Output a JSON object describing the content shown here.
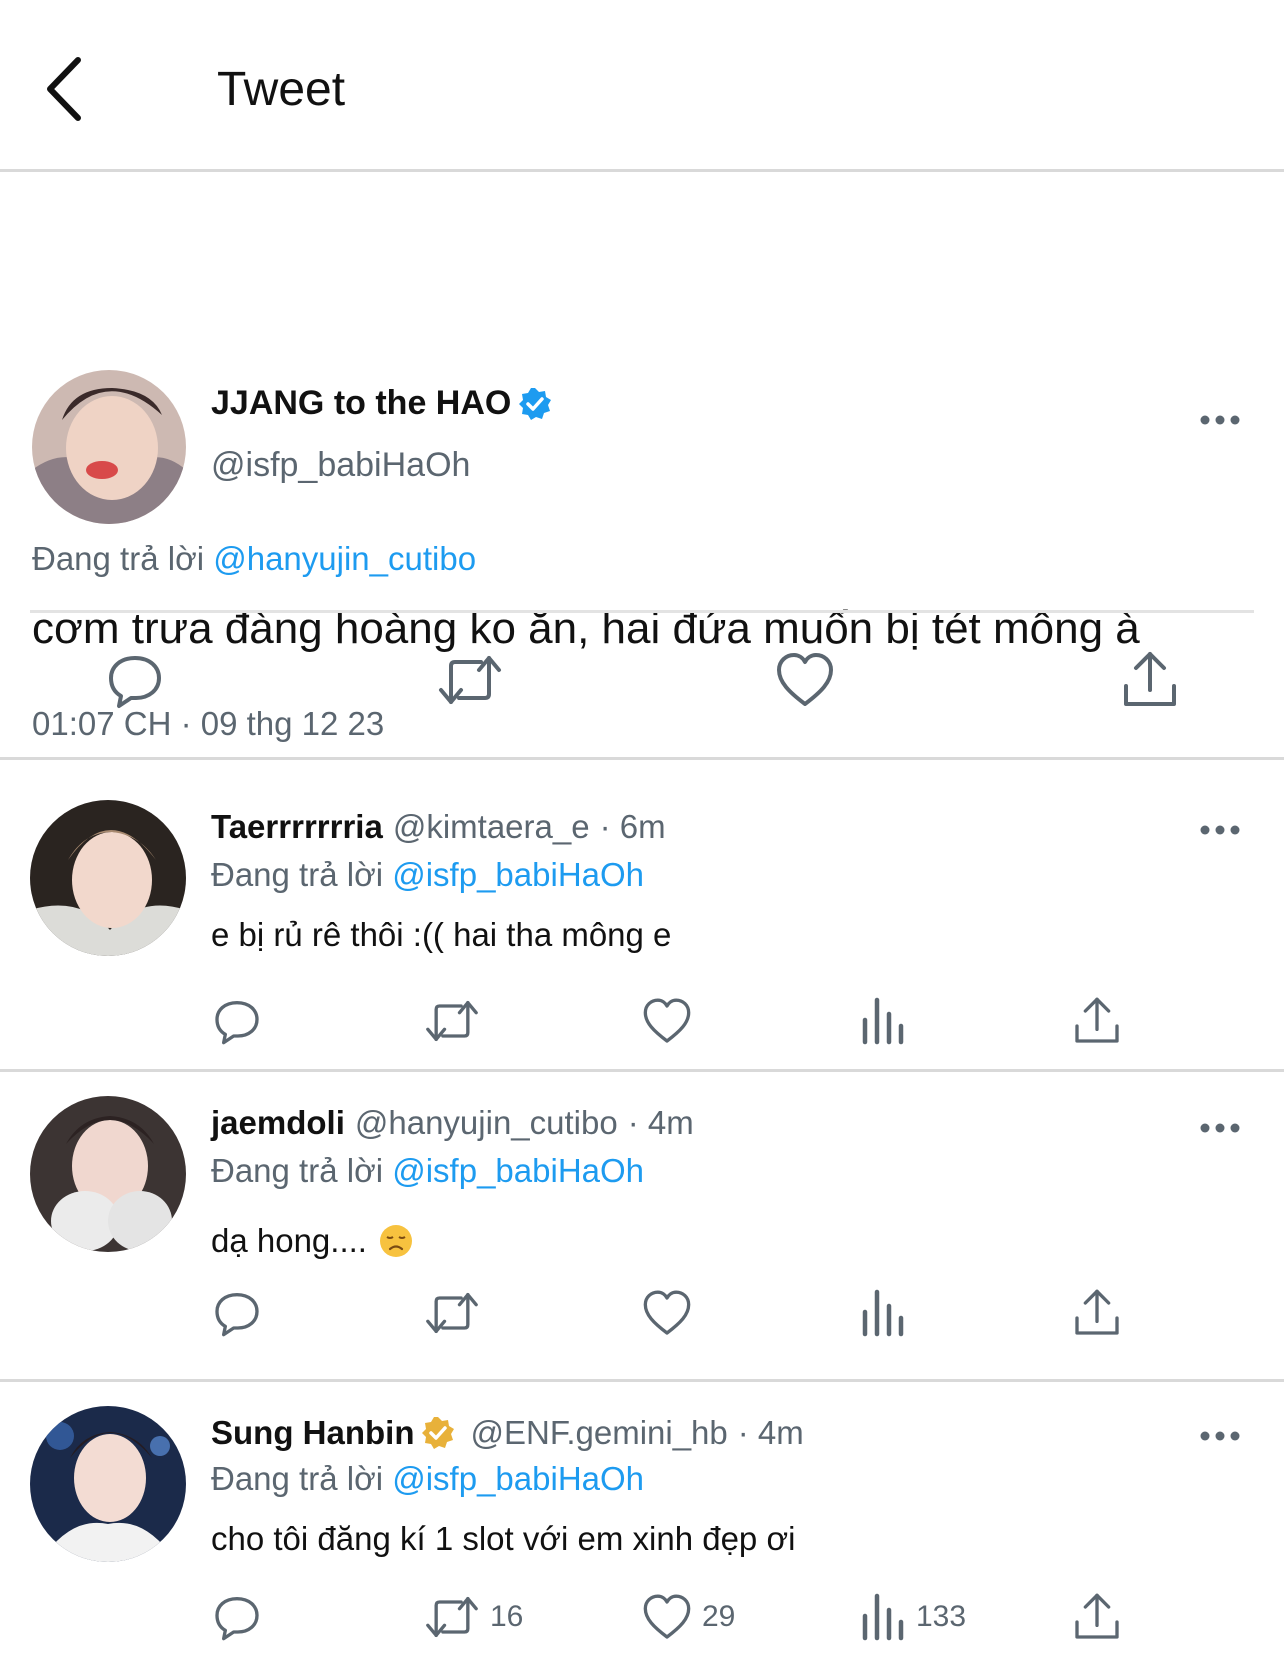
{
  "header": {
    "title": "Tweet"
  },
  "main_tweet": {
    "author_name": "JJANG to the HAO",
    "handle": "@isfp_babiHaOh",
    "reply_prefix": "Đang trả lời",
    "reply_to": "@hanyujin_cutibo",
    "text": "cơm trưa đàng hoàng ko ăn, hai đứa muốn bị tét mông à",
    "timestamp": "01:07 CH · 09 thg 12 23"
  },
  "replies": [
    {
      "author_name": "Taerrrrrrria",
      "handle": "@kimtaera_e",
      "time": "· 6m",
      "reply_prefix": "Đang trả lời",
      "reply_to": "@isfp_babiHaOh",
      "text": "e bị rủ rê thôi :(( hai tha mông e"
    },
    {
      "author_name": "jaemdoli",
      "handle": "@hanyujin_cutibo",
      "time": "· 4m",
      "reply_prefix": "Đang trả lời",
      "reply_to": "@isfp_babiHaOh",
      "text": "dạ hong...."
    },
    {
      "author_name": "Sung Hanbin",
      "handle": "@ENF.gemini_hb",
      "time": "· 4m",
      "reply_prefix": "Đang trả lời",
      "reply_to": "@isfp_babiHaOh",
      "text": "cho tôi đăng kí 1 slot với em xinh đẹp ơi",
      "retweet_count": "16",
      "like_count": "29",
      "view_count": "133"
    }
  ],
  "colors": {
    "accent": "#1d9bf0",
    "gold_badge": "#e8b13a",
    "muted": "#5b6670",
    "divider": "#d9d9d9"
  },
  "icons": [
    "back-arrow-icon",
    "verified-badge-icon",
    "gold-verified-badge-icon",
    "more-icon",
    "reply-icon",
    "retweet-icon",
    "like-icon",
    "views-icon",
    "share-icon",
    "sad-face-emoji"
  ]
}
